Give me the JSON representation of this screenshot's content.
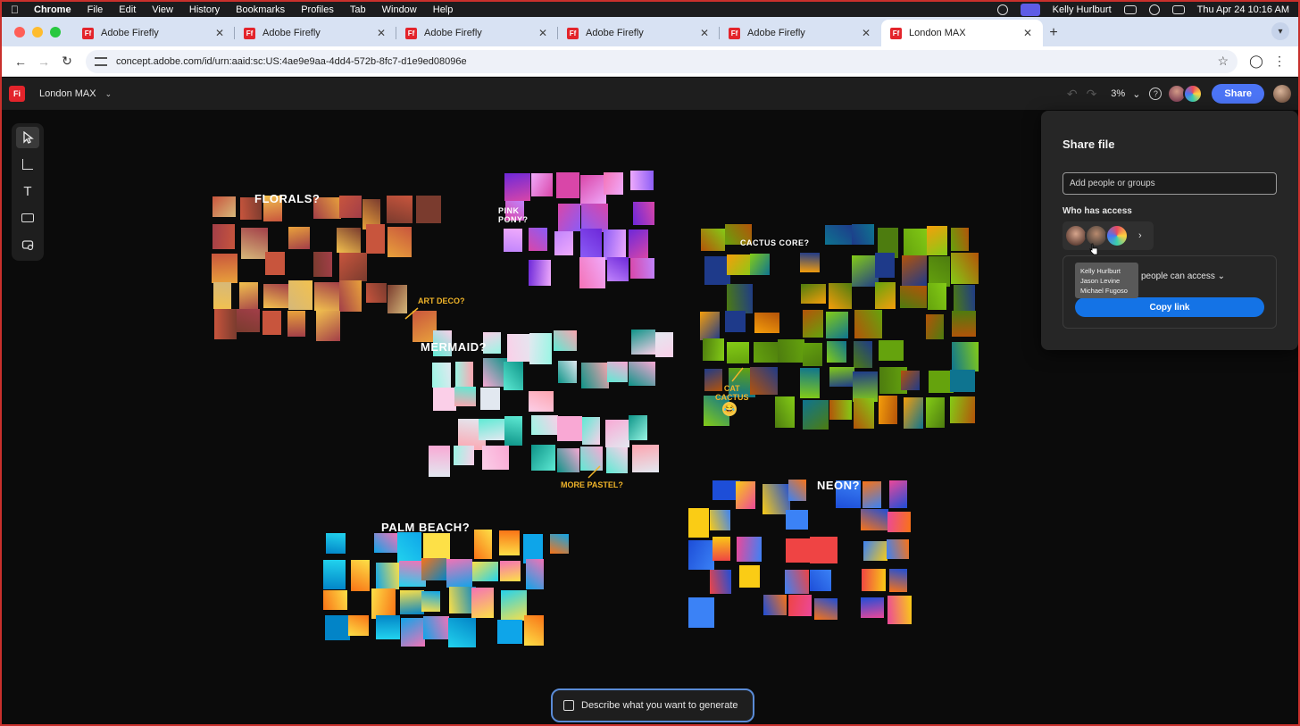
{
  "menubar": {
    "items": [
      "Chrome",
      "File",
      "Edit",
      "View",
      "History",
      "Bookmarks",
      "Profiles",
      "Tab",
      "Window",
      "Help"
    ],
    "user": "Kelly Hurlburt",
    "datetime": "Thu Apr 24  10:16 AM"
  },
  "browser": {
    "tabs": [
      {
        "label": "Adobe Firefly",
        "favicon": "Ff"
      },
      {
        "label": "Adobe Firefly",
        "favicon": "Ff"
      },
      {
        "label": "Adobe Firefly",
        "favicon": "Ff"
      },
      {
        "label": "Adobe Firefly",
        "favicon": "Ff"
      },
      {
        "label": "Adobe Firefly",
        "favicon": "Ff"
      },
      {
        "label": "London MAX",
        "favicon": "Ff",
        "active": true
      }
    ],
    "url": "concept.adobe.com/id/urn:aaid:sc:US:4ae9e9aa-4dd4-572b-8fc7-d1e9ed08096e"
  },
  "app": {
    "logo": "Fi",
    "doc_title": "London MAX",
    "zoom": "3%",
    "share_label": "Share",
    "accent": "#4b74f5"
  },
  "canvas": {
    "labels": {
      "florals": "FLORALS?",
      "pink_pony": "PINK\nPONY?",
      "cactus_core": "CACTUS CORE?",
      "mermaid": "MERMAID?",
      "palm_beach": "PALM BEACH?",
      "neon": "NEON?"
    },
    "notes": {
      "art_deco": "ART DECO?",
      "more_pastel": "MORE PASTEL?",
      "cat_cactus": "CAT\nCACTUS"
    },
    "generate_placeholder": "Describe what you want to generate"
  },
  "share_panel": {
    "title": "Share file",
    "input_placeholder": "Add people or groups",
    "who_has_access": "Who has access",
    "access_text": "people can access",
    "copy_link": "Copy link",
    "tooltip": [
      "Kelly Hurlburt",
      "Jason Levine",
      "Michael Fugoso"
    ]
  }
}
